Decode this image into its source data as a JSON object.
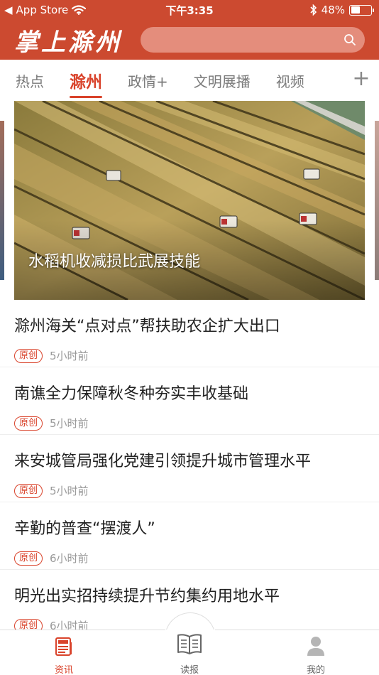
{
  "status_bar": {
    "back_app": "App Store",
    "time": "下午3:35",
    "battery": "48%",
    "battery_level": 0.48
  },
  "app_bar": {
    "logo_text": "掌上滁州"
  },
  "tabs": [
    {
      "label": "热点",
      "active": false
    },
    {
      "label": "滁州",
      "active": true
    },
    {
      "label": "政情+",
      "active": false
    },
    {
      "label": "文明展播",
      "active": false
    },
    {
      "label": "视频",
      "active": false
    }
  ],
  "carousel": {
    "caption": "水稻机收减损比武展技能"
  },
  "news": [
    {
      "title": "滁州海关“点对点”帮扶助农企扩大出口",
      "tag": "原创",
      "time": "5小时前"
    },
    {
      "title": "南谯全力保障秋冬种夯实丰收基础",
      "tag": "原创",
      "time": "5小时前"
    },
    {
      "title": "来安城管局强化党建引领提升城市管理水平",
      "tag": "原创",
      "time": "5小时前"
    },
    {
      "title": "辛勤的普查“摆渡人”",
      "tag": "原创",
      "time": "6小时前"
    },
    {
      "title": "明光出实招持续提升节约集约用地水平",
      "tag": "原创",
      "time": "6小时前"
    }
  ],
  "bottom_nav": [
    {
      "label": "资讯",
      "icon": "newspaper-icon",
      "active": true
    },
    {
      "label": "读报",
      "icon": "open-book-icon",
      "active": false
    },
    {
      "label": "我的",
      "icon": "user-icon",
      "active": false
    }
  ],
  "colors": {
    "brand_red": "#cc4a30",
    "accent": "#d9432b"
  }
}
